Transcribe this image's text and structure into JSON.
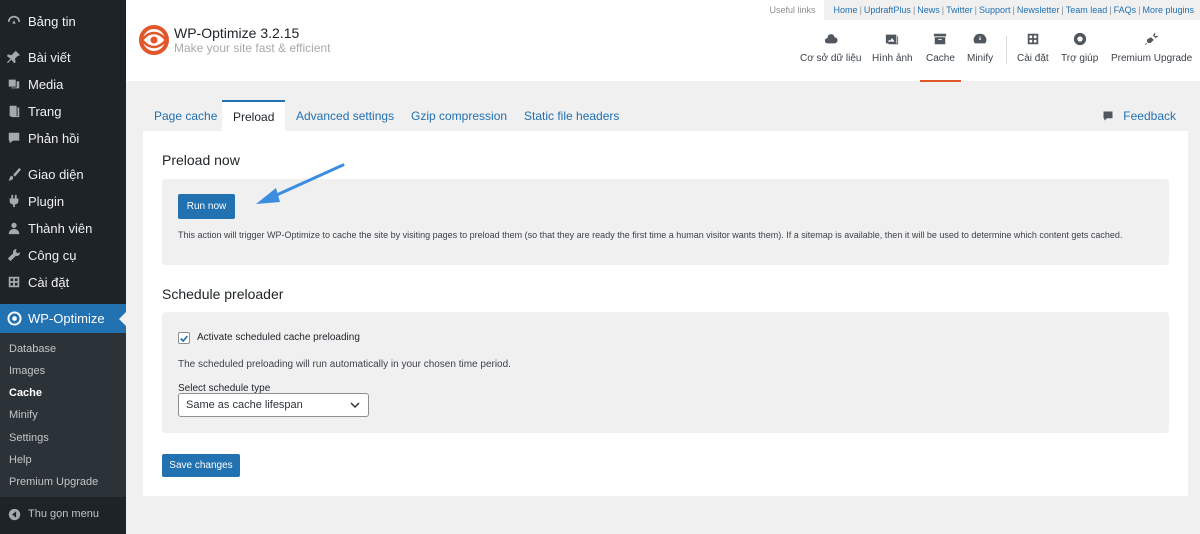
{
  "sidebar": {
    "items": [
      {
        "label": "Bảng tin",
        "icon": "dashboard-icon"
      },
      {
        "label": "Bài viết",
        "icon": "pin-icon"
      },
      {
        "label": "Media",
        "icon": "media-icon"
      },
      {
        "label": "Trang",
        "icon": "page-icon"
      },
      {
        "label": "Phản hồi",
        "icon": "comment-icon"
      },
      {
        "label": "Giao diện",
        "icon": "brush-icon"
      },
      {
        "label": "Plugin",
        "icon": "plugin-icon"
      },
      {
        "label": "Thành viên",
        "icon": "user-icon"
      },
      {
        "label": "Công cụ",
        "icon": "wrench-icon"
      },
      {
        "label": "Cài đặt",
        "icon": "settings-icon"
      }
    ],
    "current": {
      "label": "WP-Optimize",
      "icon": "wpo-icon"
    },
    "submenu": [
      "Database",
      "Images",
      "Cache",
      "Minify",
      "Settings",
      "Help",
      "Premium Upgrade"
    ],
    "active_sub": "Cache",
    "collapse_label": "Thu gọn menu"
  },
  "header": {
    "title": "WP-Optimize 3.2.15",
    "tagline": "Make your site fast & efficient",
    "useful_links_label": "Useful links",
    "links": [
      "Home",
      "UpdraftPlus",
      "News",
      "Twitter",
      "Support",
      "Newsletter",
      "Team lead",
      "FAQs",
      "More plugins"
    ],
    "nav": [
      {
        "label": "Cơ sở dữ liệu",
        "icon": "cloud-icon"
      },
      {
        "label": "Hình ảnh",
        "icon": "images-icon"
      },
      {
        "label": "Cache",
        "icon": "archive-icon"
      },
      {
        "label": "Minify",
        "icon": "dashboard-gauge-icon"
      },
      {
        "label": "Cài đặt",
        "icon": "admin-settings-icon"
      },
      {
        "label": "Trợ giúp",
        "icon": "lifebuoy-icon"
      },
      {
        "label": "Premium Upgrade",
        "icon": "plug-icon"
      }
    ],
    "active_nav": "Cache"
  },
  "tabs": {
    "items": [
      "Page cache",
      "Preload",
      "Advanced settings",
      "Gzip compression",
      "Static file headers"
    ],
    "active": "Preload",
    "feedback": "Feedback"
  },
  "preload": {
    "heading": "Preload now",
    "run_button": "Run now",
    "description": "This action will trigger WP-Optimize to cache the site by visiting pages to preload them (so that they are ready the first time a human visitor wants them). If a sitemap is available, then it will be used to determine which content gets cached."
  },
  "schedule": {
    "heading": "Schedule preloader",
    "checkbox_label": "Activate scheduled cache preloading",
    "checkbox_checked": true,
    "description": "The scheduled preloading will run automatically in your chosen time period.",
    "select_label": "Select schedule type",
    "select_value": "Same as cache lifespan"
  },
  "save_button": "Save changes",
  "colors": {
    "accent": "#2271b1",
    "sidebar": "#1d2327",
    "brand": "#e2572a",
    "annotation": "#3b8de0"
  }
}
